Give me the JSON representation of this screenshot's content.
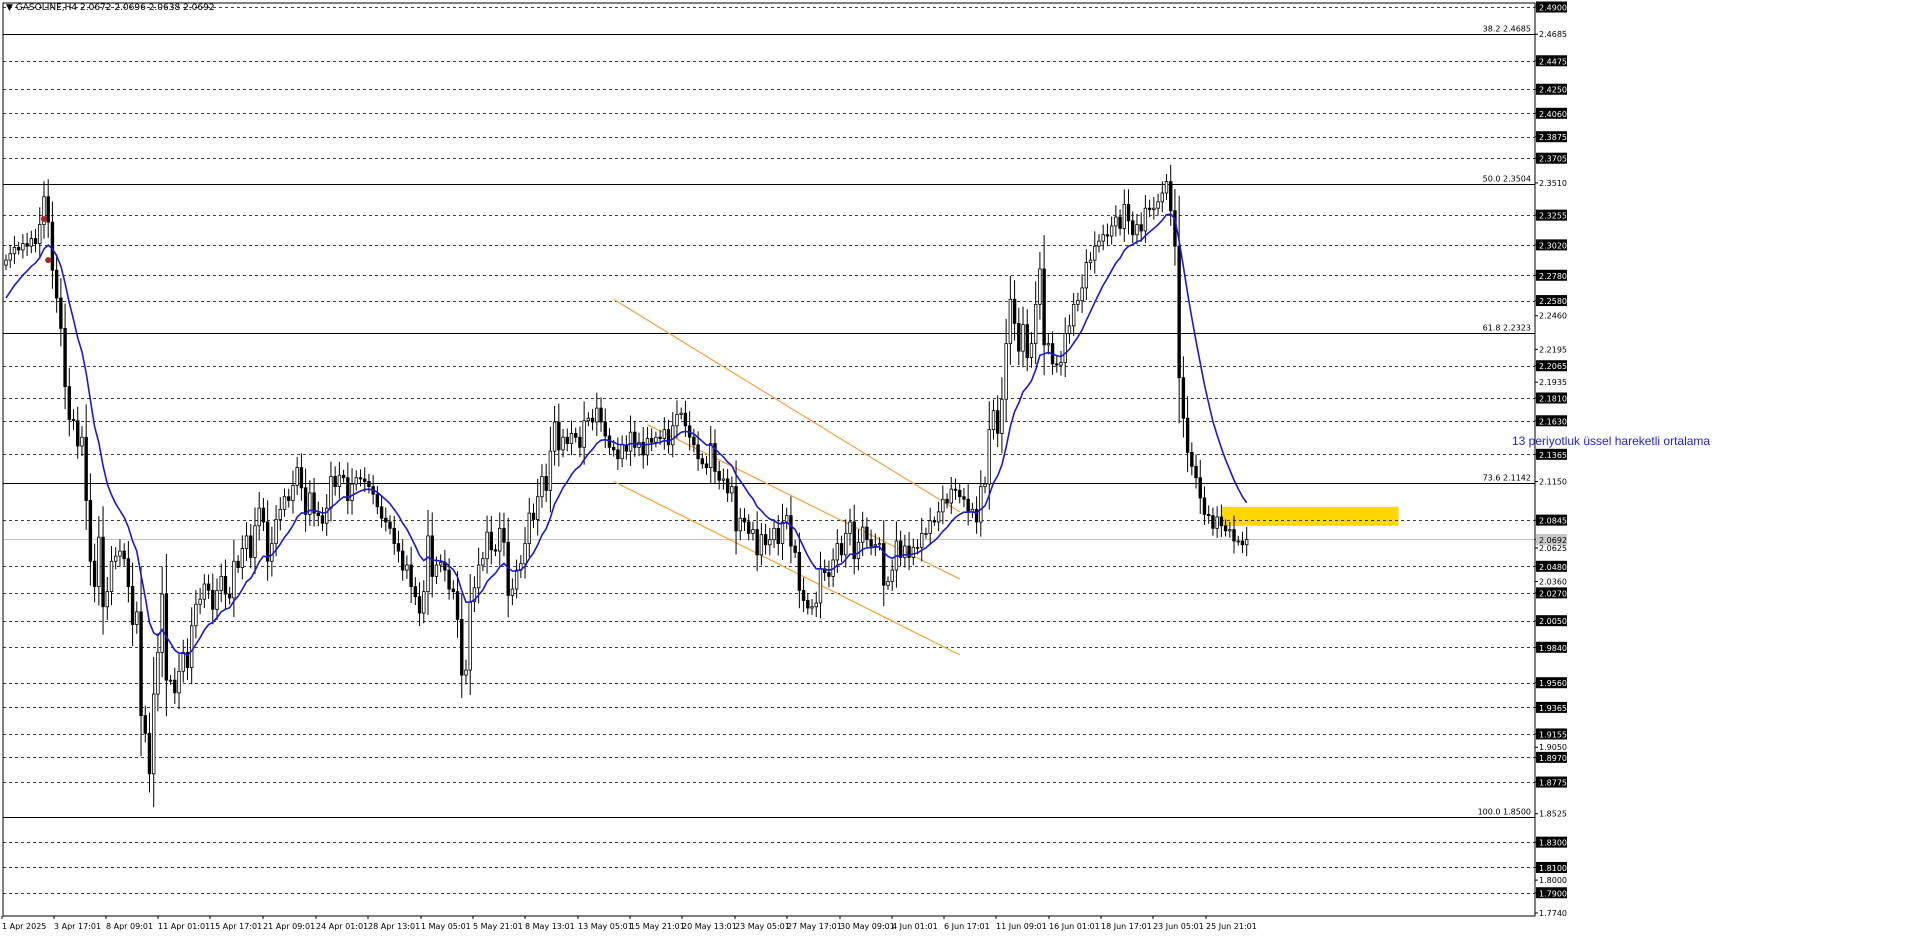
{
  "header": {
    "title": "▼ GASOLINE,H4  2.0672 2.0696 2.0638 2.0692"
  },
  "annotation_text": "13 periyotluk üssel hareketli ortalama",
  "colors": {
    "background": "#ffffff",
    "candles": "#000000",
    "ema": "#1a1acc",
    "channel": "#f5a045",
    "highlight_box": "#ffd700",
    "grid": "#000000",
    "current_price": "#c8c8c8",
    "marker": "#b22222"
  },
  "chart_data": {
    "type": "candlestick",
    "symbol": "GASOLINE",
    "timeframe": "H4",
    "ohlc": {
      "open": 2.0672,
      "high": 2.0696,
      "low": 2.0638,
      "close": 2.0692
    },
    "ylim": [
      1.774,
      2.49
    ],
    "x_ticks": [
      "1 Apr 2025",
      "3 Apr 17:01",
      "8 Apr 09:01",
      "11 Apr 01:01",
      "15 Apr 17:01",
      "21 Apr 09:01",
      "24 Apr 01:01",
      "28 Apr 13:01",
      "1 May 05:01",
      "5 May 21:01",
      "8 May 13:01",
      "13 May 05:01",
      "15 May 21:01",
      "20 May 13:01",
      "23 May 05:01",
      "27 May 17:01",
      "30 May 09:01",
      "4 Jun 01:01",
      "6 Jun 17:01",
      "11 Jun 09:01",
      "16 Jun 01:01",
      "18 Jun 17:01",
      "23 Jun 05:01",
      "25 Jun 21:01"
    ],
    "y_ticks": [
      "2.4900",
      "2.4685",
      "2.4475",
      "2.4250",
      "2.4060",
      "2.3875",
      "2.3705",
      "2.3510",
      "2.3255",
      "2.3020",
      "2.2780",
      "2.2580",
      "2.2460",
      "2.2195",
      "2.2065",
      "2.1935",
      "2.1810",
      "2.1630",
      "2.1365",
      "2.1150",
      "2.0845",
      "2.0692",
      "2.0625",
      "2.0480",
      "2.0360",
      "2.0270",
      "2.0050",
      "1.9840",
      "1.9560",
      "1.9365",
      "1.9155",
      "1.9050",
      "1.8970",
      "1.8775",
      "1.8525",
      "1.8300",
      "1.8100",
      "1.8000",
      "1.7900",
      "1.7740"
    ],
    "highlighted_levels": [
      "2.4900",
      "2.4475",
      "2.4250",
      "2.4060",
      "2.3875",
      "2.3705",
      "2.3255",
      "2.3020",
      "2.2780",
      "2.2580",
      "2.2065",
      "2.1810",
      "2.1630",
      "2.1365",
      "2.0845",
      "2.0692",
      "2.0480",
      "2.0270",
      "2.0050",
      "1.9840",
      "1.9560",
      "1.9365",
      "1.9155",
      "1.8970",
      "1.8775",
      "1.8300",
      "1.8100",
      "1.7900"
    ],
    "dashed_levels": [
      2.49,
      2.4475,
      2.425,
      2.406,
      2.3875,
      2.3705,
      2.3255,
      2.302,
      2.278,
      2.258,
      2.2065,
      2.181,
      2.163,
      2.1365,
      2.0845,
      2.048,
      2.027,
      2.005,
      1.984,
      1.956,
      1.9365,
      1.9155,
      1.897,
      1.8775,
      1.83,
      1.81,
      1.79
    ],
    "current_price": 2.0692,
    "fibonacci": [
      {
        "label": "38.2 2.4685",
        "value": 2.4685
      },
      {
        "label": "50.0 2.3504",
        "value": 2.3504
      },
      {
        "label": "61.8 2.2323",
        "value": 2.2323
      },
      {
        "label": "73.6 2.1142",
        "value": 2.1142
      },
      {
        "label": "100.0 1.8500",
        "value": 1.85
      }
    ],
    "highlight_zone": {
      "start_index": 288,
      "end_index": 330,
      "y_from": 2.08,
      "y_to": 2.095
    },
    "channel": {
      "upper": [
        [
          144,
          2.259
        ],
        [
          226,
          2.091
        ]
      ],
      "lower": [
        [
          144,
          2.115
        ],
        [
          226,
          1.978
        ]
      ],
      "middle": [
        [
          152,
          2.16
        ],
        [
          226,
          2.038
        ]
      ]
    },
    "ema_period": 13,
    "marker_points": [
      [
        9,
        2.3225
      ],
      [
        10,
        2.29
      ]
    ],
    "closes": [
      2.29,
      2.295,
      2.3,
      2.298,
      2.303,
      2.301,
      2.307,
      2.303,
      2.318,
      2.34,
      2.32,
      2.282,
      2.26,
      2.236,
      2.19,
      2.164,
      2.163,
      2.143,
      2.15,
      2.1,
      2.052,
      2.032,
      2.071,
      2.016,
      2.028,
      2.052,
      2.056,
      2.06,
      2.054,
      2.032,
      2.002,
      2.012,
      1.93,
      1.916,
      1.884,
      1.947,
      1.98,
      2.026,
      1.958,
      1.958,
      1.948,
      1.965,
      1.98,
      1.968,
      2.001,
      2.018,
      2.022,
      2.034,
      2.029,
      2.014,
      2.029,
      2.04,
      2.026,
      2.023,
      2.052,
      2.047,
      2.062,
      2.072,
      2.055,
      2.08,
      2.094,
      2.083,
      2.052,
      2.066,
      2.085,
      2.093,
      2.103,
      2.1,
      2.112,
      2.126,
      2.11,
      2.089,
      2.106,
      2.09,
      2.088,
      2.082,
      2.094,
      2.119,
      2.111,
      2.12,
      2.118,
      2.1,
      2.113,
      2.118,
      2.117,
      2.115,
      2.111,
      2.105,
      2.095,
      2.086,
      2.083,
      2.078,
      2.066,
      2.06,
      2.045,
      2.049,
      2.032,
      2.024,
      2.011,
      2.028,
      2.072,
      2.04,
      2.049,
      2.051,
      2.045,
      2.03,
      2.028,
      2.006,
      1.962,
      1.966,
      2.02,
      2.031,
      2.049,
      2.054,
      2.075,
      2.061,
      2.06,
      2.078,
      2.067,
      2.025,
      2.03,
      2.045,
      2.05,
      2.066,
      2.09,
      2.085,
      2.103,
      2.119,
      2.108,
      2.139,
      2.162,
      2.14,
      2.15,
      2.145,
      2.153,
      2.15,
      2.142,
      2.163,
      2.165,
      2.162,
      2.173,
      2.162,
      2.151,
      2.142,
      2.14,
      2.133,
      2.144,
      2.139,
      2.154,
      2.142,
      2.146,
      2.136,
      2.149,
      2.146,
      2.15,
      2.149,
      2.156,
      2.144,
      2.159,
      2.168,
      2.169,
      2.159,
      2.15,
      2.144,
      2.133,
      2.129,
      2.126,
      2.145,
      2.123,
      2.116,
      2.117,
      2.106,
      2.111,
      2.076,
      2.086,
      2.083,
      2.074,
      2.077,
      2.057,
      2.073,
      2.065,
      2.069,
      2.078,
      2.066,
      2.083,
      2.088,
      2.064,
      2.059,
      2.029,
      2.021,
      2.015,
      2.016,
      2.019,
      2.046,
      2.043,
      2.04,
      2.053,
      2.066,
      2.057,
      2.074,
      2.083,
      2.054,
      2.067,
      2.079,
      2.069,
      2.064,
      2.065,
      2.066,
      2.033,
      2.036,
      2.045,
      2.068,
      2.055,
      2.064,
      2.055,
      2.063,
      2.063,
      2.074,
      2.074,
      2.084,
      2.083,
      2.091,
      2.101,
      2.098,
      2.109,
      2.108,
      2.103,
      2.101,
      2.091,
      2.093,
      2.083,
      2.111,
      2.113,
      2.156,
      2.171,
      2.153,
      2.18,
      2.224,
      2.259,
      2.24,
      2.218,
      2.239,
      2.213,
      2.224,
      2.255,
      2.283,
      2.223,
      2.224,
      2.208,
      2.207,
      2.209,
      2.232,
      2.238,
      2.255,
      2.258,
      2.268,
      2.288,
      2.29,
      2.301,
      2.305,
      2.31,
      2.309,
      2.317,
      2.324,
      2.315,
      2.334,
      2.321,
      2.31,
      2.318,
      2.313,
      2.331,
      2.33,
      2.331,
      2.336,
      2.343,
      2.352,
      2.329,
      2.301,
      2.197,
      2.165,
      2.138,
      2.127,
      2.118,
      2.102,
      2.089,
      2.088,
      2.078,
      2.087,
      2.08,
      2.076,
      2.077,
      2.068,
      2.068,
      2.065,
      2.0692
    ]
  }
}
